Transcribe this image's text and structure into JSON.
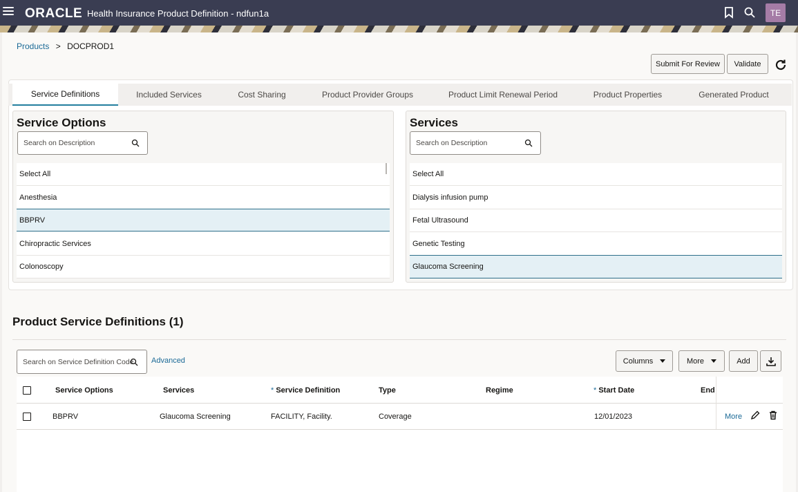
{
  "header": {
    "logo": "ORACLE",
    "app_title": "Health Insurance Product Definition - ndfun1a",
    "avatar_initials": "TE",
    "bg_color": "#3a3d52"
  },
  "breadcrumb": {
    "parent": "Products",
    "separator": ">",
    "current": "DOCPROD1"
  },
  "actions": {
    "submit": "Submit For Review",
    "validate": "Validate"
  },
  "tabs": [
    {
      "label": "Service Definitions",
      "active": true
    },
    {
      "label": "Included Services"
    },
    {
      "label": "Cost Sharing"
    },
    {
      "label": "Product Provider Groups"
    },
    {
      "label": "Product Limit Renewal Period"
    },
    {
      "label": "Product Properties"
    },
    {
      "label": "Generated Product"
    }
  ],
  "service_options": {
    "title": "Service Options",
    "search_placeholder": "Search on Description",
    "items": [
      "Select All",
      "Anesthesia",
      "BBPRV",
      "Chiropractic Services",
      "Colonoscopy"
    ],
    "selected": "BBPRV"
  },
  "services": {
    "title": "Services",
    "search_placeholder": "Search on Description",
    "items": [
      "Select All",
      "Dialysis infusion pump",
      "Fetal Ultrasound",
      "Genetic Testing",
      "Glaucoma Screening"
    ],
    "selected": "Glaucoma Screening"
  },
  "definitions": {
    "title": "Product Service Definitions (1)",
    "search_placeholder": "Search on Service Definition Code",
    "advanced": "Advanced",
    "columns_btn": "Columns",
    "more_btn": "More",
    "add_btn": "Add",
    "headers": {
      "service_options": "Service Options",
      "services": "Services",
      "service_definition": "Service Definition",
      "type": "Type",
      "regime": "Regime",
      "start_date": "Start Date",
      "end": "End",
      "required_mark": "*"
    },
    "rows": [
      {
        "service_option": "BBPRV",
        "service": "Glaucoma Screening",
        "service_definition": "FACILITY, Facility.",
        "type": "Coverage",
        "regime": "",
        "start_date": "12/01/2023",
        "more": "More"
      }
    ]
  },
  "accent_color": "#1a6996"
}
